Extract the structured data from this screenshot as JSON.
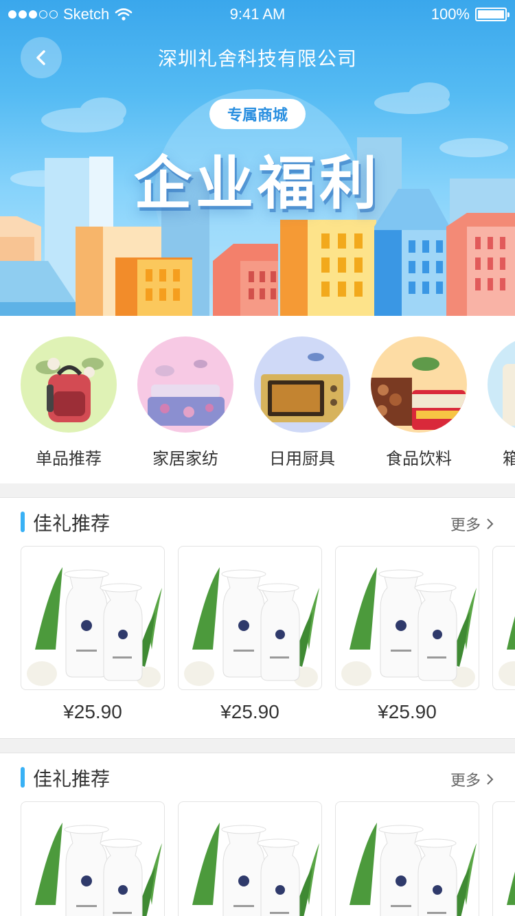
{
  "status_bar": {
    "carrier": "Sketch",
    "time": "9:41 AM",
    "battery": "100%"
  },
  "nav": {
    "title": "深圳礼舍科技有限公司"
  },
  "hero": {
    "badge": "专属商城",
    "title": "企业福利"
  },
  "categories": [
    {
      "label": "单品推荐",
      "icon": "backpack-icon",
      "bg": "#dff2b5"
    },
    {
      "label": "家居家纺",
      "icon": "bedding-icon",
      "bg": "#f7c9e4"
    },
    {
      "label": "日用厨具",
      "icon": "oven-icon",
      "bg": "#cfd9f7"
    },
    {
      "label": "食品饮料",
      "icon": "snacks-icon",
      "bg": "#fddca4"
    },
    {
      "label": "箱",
      "icon": "luggage-icon",
      "bg": "#cdeaf8"
    }
  ],
  "sections": [
    {
      "title": "佳礼推荐",
      "more": "更多",
      "products": [
        {
          "price": "¥25.90"
        },
        {
          "price": "¥25.90"
        },
        {
          "price": "¥25.90"
        }
      ]
    },
    {
      "title": "佳礼推荐",
      "more": "更多",
      "products": [
        {
          "price": ""
        },
        {
          "price": ""
        },
        {
          "price": ""
        }
      ]
    }
  ],
  "colors": {
    "accent": "#39b1f5",
    "hero_top": "#3aa7ec",
    "badge_text": "#2a8fe0"
  }
}
